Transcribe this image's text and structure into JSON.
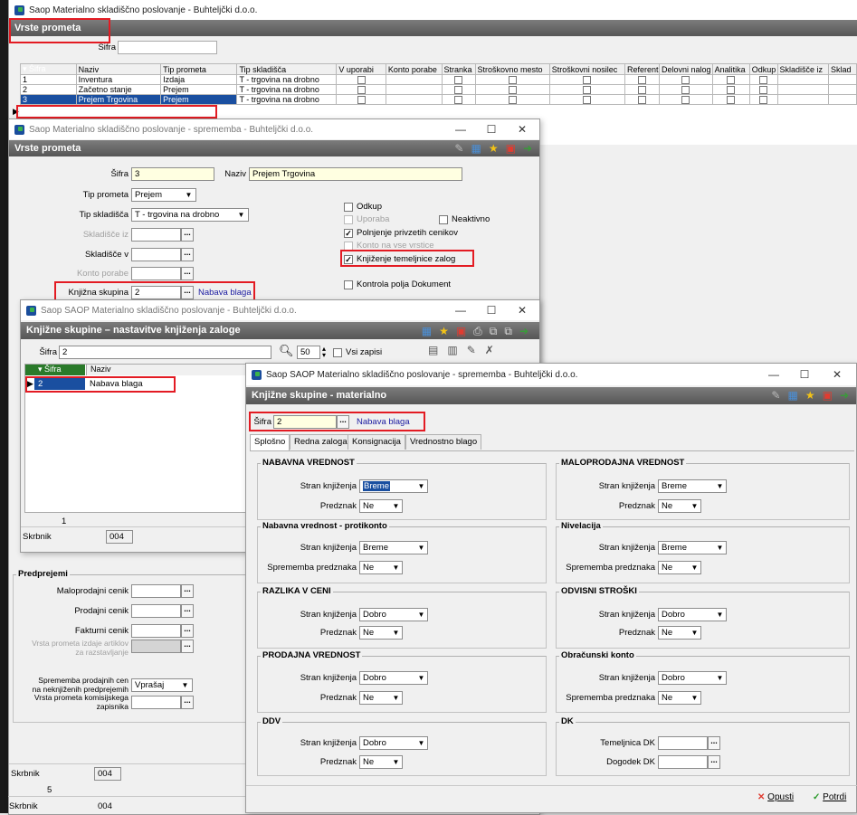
{
  "main": {
    "title": "Saop Materialno skladiščno poslovanje - Buhteljčki d.o.o.",
    "header": "Vrste prometa",
    "filter_label": "Šifra",
    "columns": [
      "▾ Šifra",
      "Naziv",
      "Tip prometa",
      "Tip skladišča",
      "V uporabi",
      "Konto porabe",
      "Stranka",
      "Stroškovno mesto",
      "Stroškovni nosilec",
      "Referent",
      "Delovni nalog",
      "Analitika",
      "Odkup",
      "Skladišče iz",
      "Sklad"
    ],
    "rows": [
      [
        "1",
        "Inventura",
        "Izdaja",
        "T - trgovina na drobno"
      ],
      [
        "2",
        "Začetno stanje",
        "Prejem",
        "T - trgovina na drobno"
      ],
      [
        "3",
        "Prejem Trgovina",
        "Prejem",
        "T - trgovina na drobno"
      ]
    ],
    "footer": {
      "label": "Skrbnik",
      "value": "004",
      "counter": "5",
      "label2": "Skrbnik",
      "value2": "004"
    }
  },
  "vp": {
    "title": "Saop Materialno skladiščno poslovanje - sprememba - Buhteljčki d.o.o.",
    "header": "Vrste prometa",
    "sifra_label": "Šifra",
    "sifra": "3",
    "naziv_label": "Naziv",
    "naziv": "Prejem Trgovina",
    "tip_prometa_label": "Tip prometa",
    "tip_prometa": "Prejem",
    "tip_skladisca_label": "Tip skladišča",
    "tip_skladisca": "T - trgovina na drobno",
    "skl_iz_label": "Skladišče iz",
    "skl_v_label": "Skladišče v",
    "konto_label": "Konto porabe",
    "kg_label": "Knjižna skupina",
    "kg": "2",
    "kg_name": "Nabava blaga",
    "odkup": "Odkup",
    "uporaba": "Uporaba",
    "neaktivno": "Neaktivno",
    "polnjenje": "Polnjenje privzetih cenikov",
    "konto_vse": "Konto na vse vrstice",
    "knjizenje": "Knjiženje temeljnice zalog",
    "kontrola": "Kontrola polja Dokument",
    "pred": {
      "title": "Predprejemi",
      "malo": "Maloprodajni cenik",
      "prod": "Prodajni cenik",
      "fakt": "Fakturni cenik",
      "vrsta1": "Vrsta prometa izdaje artiklov",
      "vrsta2": "za razstavljanje",
      "sprem1": "Sprememba prodajnih cen",
      "sprem2": "na neknjiženih predprejemih",
      "sprem_val": "Vprašaj",
      "kom1": "Vrsta prometa komisijskega",
      "kom2": "zapisnika"
    },
    "skrbnik": "Skrbnik",
    "skrbnik_val": "004"
  },
  "ks": {
    "title": "Saop SAOP Materialno skladiščno poslovanje - Buhteljčki d.o.o.",
    "header": "Knjižne skupine – nastavitve knjiženja zaloge",
    "sifra_label": "Šifra",
    "sifra": "2",
    "count": "50",
    "vsi": "Vsi zapisi",
    "col1": "▾ Šifra",
    "col2": "Naziv",
    "row_sifra": "2",
    "row_naziv": "Nabava blaga",
    "counter": "1",
    "skrbnik": "Skrbnik",
    "skrbnik_val": "004"
  },
  "km": {
    "title": "Saop SAOP Materialno skladiščno poslovanje - sprememba - Buhteljčki d.o.o.",
    "header": "Knjižne skupine - materialno",
    "sifra_label": "Šifra",
    "sifra": "2",
    "sifra_name": "Nabava blaga",
    "tabs": [
      "Splošno",
      "Redna zaloga",
      "Konsignacija",
      "Vrednostno blago"
    ],
    "stran": "Stran knjiženja",
    "predznak": "Predznak",
    "sprem": "Sprememba predznaka",
    "g1": {
      "title": "NABAVNA VREDNOST",
      "stran": "Breme",
      "pred": "Ne"
    },
    "g2": {
      "title": "Nabavna vrednost - protikonto",
      "stran": "Breme",
      "pred": "Ne"
    },
    "g3": {
      "title": "RAZLIKA V CENI",
      "stran": "Dobro",
      "pred": "Ne"
    },
    "g4": {
      "title": "PRODAJNA VREDNOST",
      "stran": "Dobro",
      "pred": "Ne"
    },
    "g5": {
      "title": "DDV",
      "stran": "Dobro",
      "pred": "Ne"
    },
    "g6": {
      "title": "MALOPRODAJNA VREDNOST",
      "stran": "Breme",
      "pred": "Ne"
    },
    "g7": {
      "title": "Nivelacija",
      "stran": "Breme",
      "pred": "Ne"
    },
    "g8": {
      "title": "ODVISNI STROŠKI",
      "stran": "Dobro",
      "pred": "Ne"
    },
    "g9": {
      "title": "Obračunski konto",
      "stran": "Dobro",
      "pred": "Ne"
    },
    "g10": {
      "title": "DK",
      "tem": "Temeljnica DK",
      "dog": "Dogodek DK"
    },
    "opusti": "Opusti",
    "potrdi": "Potrdi"
  },
  "colors": {
    "accent": "#e31b23",
    "selection": "#1a4fa0",
    "header": "#6a6a6a"
  }
}
